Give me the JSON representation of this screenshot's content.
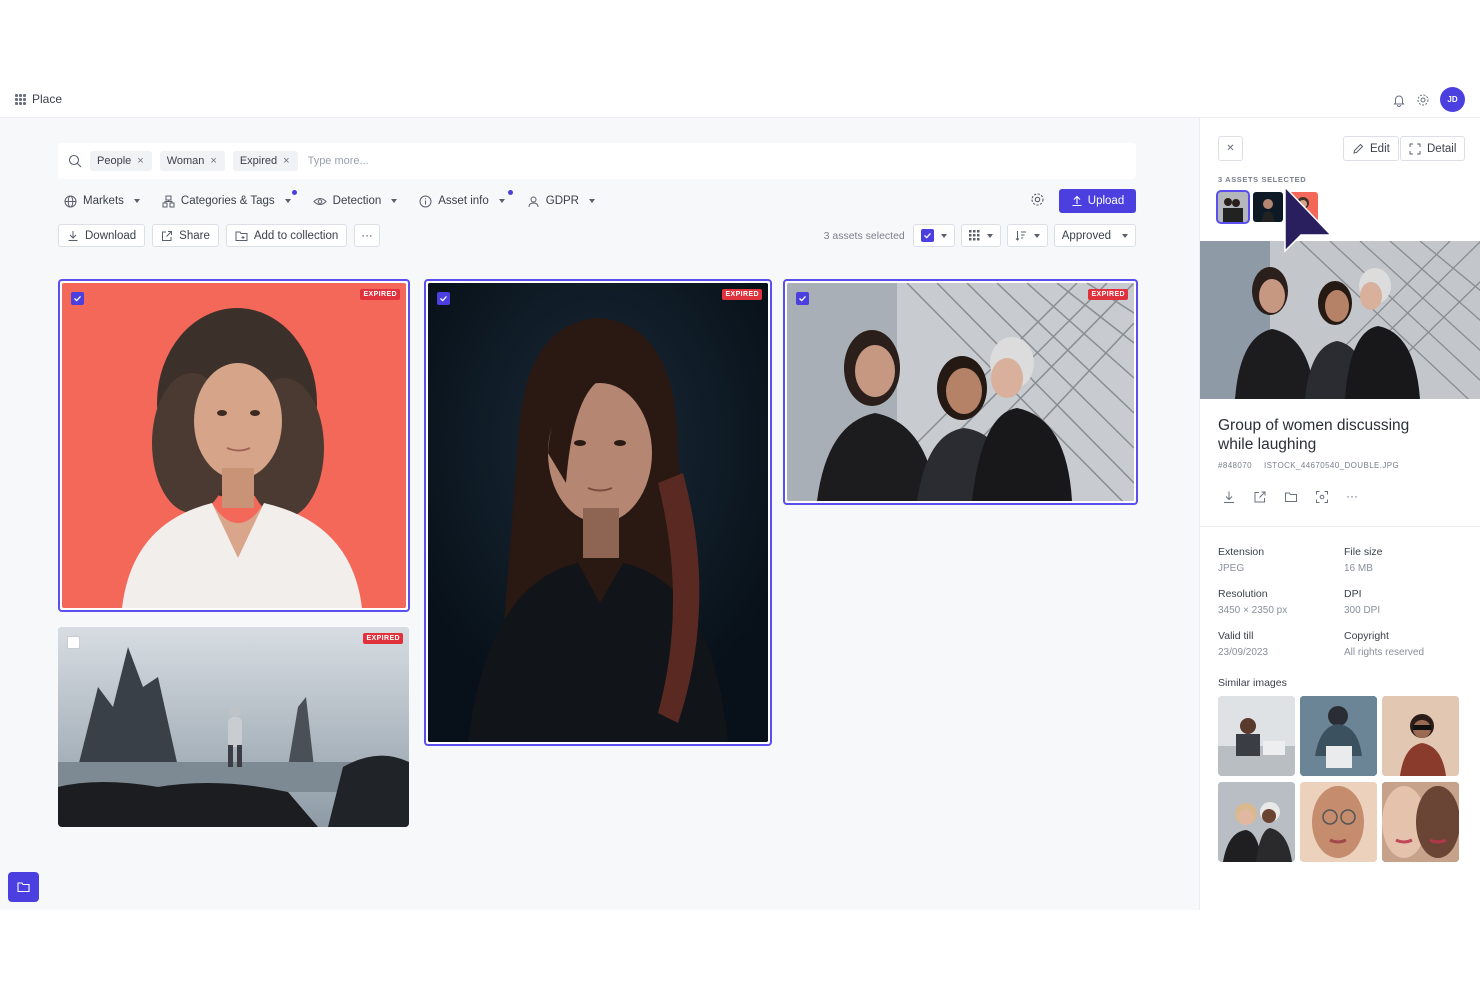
{
  "app": {
    "name": "Place",
    "avatar_initials": "JD"
  },
  "search": {
    "chips": [
      "People",
      "Woman",
      "Expired"
    ],
    "placeholder": "Type more..."
  },
  "filters": [
    {
      "label": "Markets",
      "icon": "globe-icon",
      "dot": false
    },
    {
      "label": "Categories & Tags",
      "icon": "tag-icon",
      "dot": true
    },
    {
      "label": "Detection",
      "icon": "eye-icon",
      "dot": false
    },
    {
      "label": "Asset info",
      "icon": "info-icon",
      "dot": true
    },
    {
      "label": "GDPR",
      "icon": "user-icon",
      "dot": false
    }
  ],
  "toolbar": {
    "upload": "Upload",
    "download": "Download",
    "share": "Share",
    "add_to_collection": "Add to collection",
    "more": "···",
    "selected_count": "3 assets selected",
    "status": "Approved"
  },
  "grid": {
    "badge": "EXPIRED",
    "cards": [
      {
        "name": "woman-red-background",
        "selected": true
      },
      {
        "name": "woman-dark-portrait",
        "selected": true
      },
      {
        "name": "group-of-women",
        "selected": true
      },
      {
        "name": "hiker-on-rocks",
        "selected": false
      }
    ]
  },
  "panel": {
    "edit": "Edit",
    "detail": "Detail",
    "assets_selected": "3 ASSETS SELECTED",
    "title": "Group of women discussing while laughing",
    "asset_id": "#848070",
    "file_name": "ISTOCK_44670540_DOUBLE.JPG",
    "properties": [
      {
        "key": "Extension",
        "value": "JPEG"
      },
      {
        "key": "File size",
        "value": "16 MB"
      },
      {
        "key": "Resolution",
        "value": "3450 × 2350 px"
      },
      {
        "key": "DPI",
        "value": "300 DPI"
      },
      {
        "key": "Valid till",
        "value": "23/09/2023"
      },
      {
        "key": "Copyright",
        "value": "All rights reserved"
      }
    ],
    "similar_label": "Similar images"
  },
  "colors": {
    "accent": "#4b3fe0",
    "expired": "#e0323c",
    "selection_border": "#5b4ff0"
  }
}
